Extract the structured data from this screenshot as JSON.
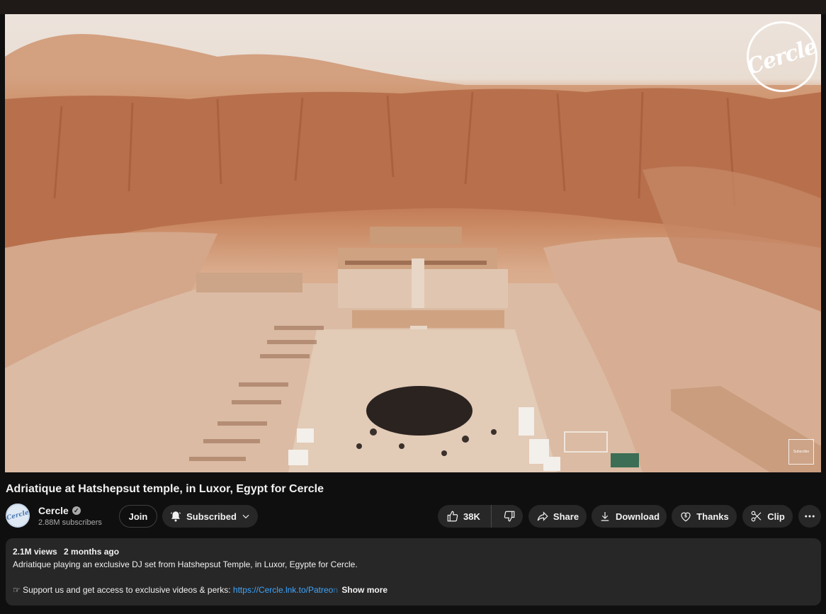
{
  "video": {
    "title": "Adriatique at Hatshepsut temple, in Luxor, Egypt for Cercle",
    "logo_text": "Cercle",
    "watermark_text": "Subscribe"
  },
  "channel": {
    "name": "Cercle",
    "verified_mark": "✓",
    "subscribers": "2.88M subscribers",
    "avatar_text": "Cercle"
  },
  "actions": {
    "join_label": "Join",
    "subscribed_label": "Subscribed",
    "like_count": "38K",
    "share_label": "Share",
    "download_label": "Download",
    "thanks_label": "Thanks",
    "clip_label": "Clip"
  },
  "description": {
    "views": "2.1M views",
    "age": "2 months ago",
    "line1": "Adriatique playing an exclusive DJ set from Hatshepsut Temple, in Luxor, Egypte for Cercle.",
    "support_prefix": "☞ Support us and get access to exclusive videos & perks: ",
    "support_link": "https://Cercle.lnk.to/Patreo",
    "support_link_faded": "n",
    "show_more": "Show more"
  },
  "icons": [
    "bell-icon",
    "chevron-down-icon",
    "thumbs-up-icon",
    "thumbs-down-icon",
    "share-icon",
    "download-icon",
    "thanks-icon",
    "scissors-icon",
    "more-icon",
    "verified-icon"
  ],
  "colors": {
    "background": "#0f0f0f",
    "pill": "#272727",
    "link": "#3ea6ff",
    "sand": "#d6b39c",
    "cliff": "#b86a48"
  }
}
